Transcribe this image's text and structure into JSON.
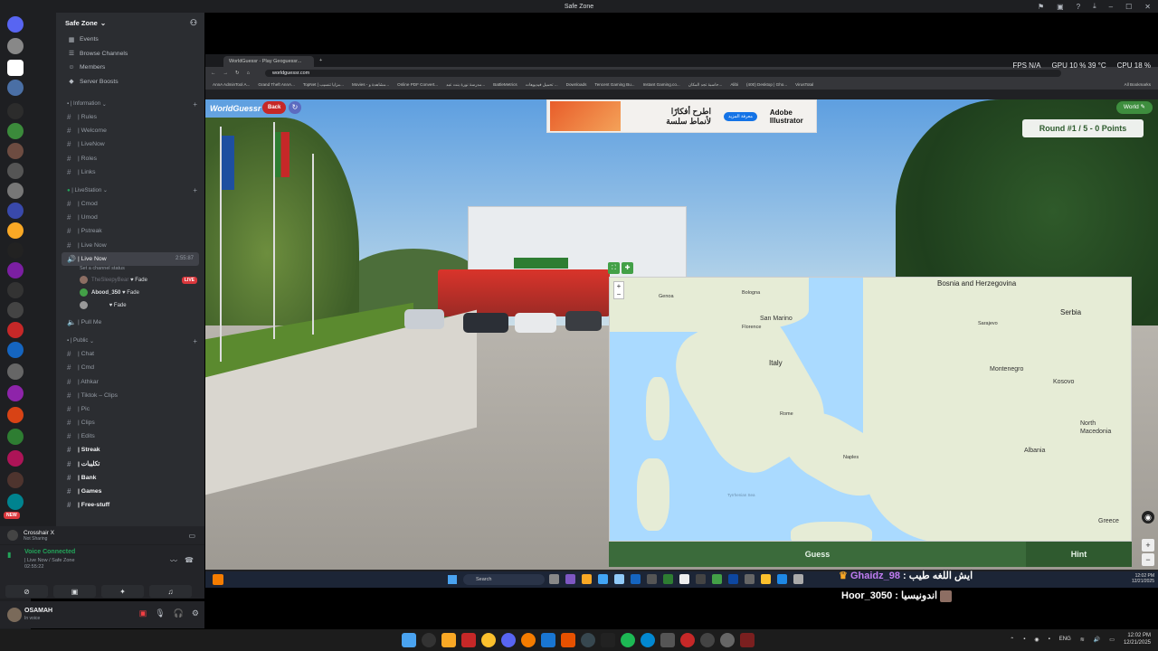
{
  "window": {
    "title": "Safe Zone"
  },
  "rail": {
    "badges": [
      "234",
      "1",
      "8",
      "221",
      "549",
      "NEW"
    ]
  },
  "sidebar": {
    "server_name": "Safe Zone",
    "nav": [
      {
        "icon": "calendar-icon",
        "label": "Events"
      },
      {
        "icon": "browse-icon",
        "label": "Browse Channels"
      },
      {
        "icon": "members-icon",
        "label": "Members"
      },
      {
        "icon": "boost-icon",
        "label": "Server Boosts"
      }
    ],
    "categories": [
      {
        "name": "| Information",
        "channels": [
          "| Rules",
          "| Welcome",
          "| LiveNow",
          "| Roles",
          "| Links"
        ]
      },
      {
        "name": "| LiveStation",
        "channels": [
          "| Cmod",
          "| Umod",
          "| Pstreak",
          "| Live Now"
        ]
      },
      {
        "name": "| Public",
        "channels": [
          "| Chat",
          "| Cmd",
          "| Athkar",
          "| Tiktok – Clips",
          "| Pic",
          "| Clips",
          "| Edits",
          "| Streak",
          "| تكليبات",
          "| Bank",
          "| Games",
          "| Free-stuff"
        ]
      }
    ],
    "active_voice": {
      "name": "| Live Now",
      "time": "2:55:87",
      "status": "Set a channel status",
      "users": [
        {
          "name": "TheSleepyBear",
          "tag": "Fade",
          "live": "LIVE"
        },
        {
          "name": "Abood_350",
          "tag": "Fade"
        },
        {
          "name": "",
          "tag": "Fade"
        }
      ]
    },
    "pull_me": "| Pull Me"
  },
  "activity": {
    "title": "Crosshair X",
    "sub": "Not Sharing"
  },
  "voice_panel": {
    "status": "Voice Connected",
    "channel": "| Live Now / Safe Zone",
    "elapsed": "02:55:22"
  },
  "user": {
    "name": "OSAMAH",
    "status": "In voice"
  },
  "browser": {
    "tab_title": "WorldGuessr - Play Geoguessr...",
    "url": "worldguessr.com",
    "fps": "FPS N/A",
    "gpu": "GPU 10 % 39 °C",
    "cpu": "CPU 18 %",
    "bookmarks": [
      "AnnA AdminTool A...",
      "Grand Theft AnnA...",
      "TopNet | مزايا تنسيب...",
      "Movies - مشاهدة و...",
      "Online PDF Convert...",
      "مدرسة نورة بنت عبد...",
      "BattleMetrics",
      "تحميل فيديوهات ...",
      "Downloads",
      "Tencent Gaming Bu...",
      "Instant Gaming.co...",
      "حاسبة تجد المكان...",
      "Alibi",
      "(400) Desktop | Gho...",
      "VirusTotal",
      "All Bookmarks"
    ]
  },
  "game": {
    "logo": "WorldGuessr",
    "back": "Back",
    "mode": "World",
    "round": "Round #1 / 5 - 0 Points",
    "ad": {
      "arabic": "اطرح أفكارًا لأنماط سلسة",
      "button": "معرفة المزيد",
      "brand1": "Adobe",
      "brand2": "Illustrator"
    },
    "map_labels": [
      "Bosnia and Herzegovina",
      "Serbia",
      "San Marino",
      "Italy",
      "Montenegro",
      "Kosovo",
      "North Macedonia",
      "Albania",
      "Greece",
      "Genoa",
      "Bologna",
      "Florence",
      "Rome",
      "Naples",
      "Sarajevo",
      "Tyrrhenian Sea"
    ],
    "guess": "Guess",
    "hint": "Hint"
  },
  "chat": {
    "line1_nick": "Ghaidz_98",
    "line1_msg": ": ايش اللغه طيب",
    "line2": "Hoor_3050 : اندونيسيا"
  },
  "inner_taskbar": {
    "search": "Search",
    "time": "12:02 PM",
    "date": "12/21/2025"
  },
  "taskbar": {
    "lang": "ENG",
    "time": "12:02 PM",
    "date": "12/21/2025"
  }
}
